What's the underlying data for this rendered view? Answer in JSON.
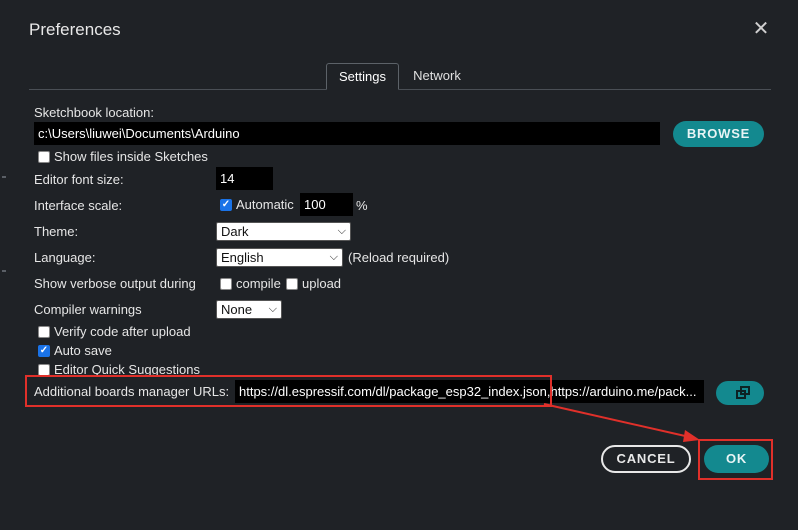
{
  "dialog": {
    "title": "Preferences"
  },
  "tabs": [
    {
      "label": "Settings",
      "active": true
    },
    {
      "label": "Network",
      "active": false
    }
  ],
  "sketchbook": {
    "label": "Sketchbook location:",
    "value": "c:\\Users\\liuwei\\Documents\\Arduino",
    "browse_label": "BROWSE",
    "show_files_label": "Show files inside Sketches",
    "show_files_checked": false
  },
  "font_size": {
    "label": "Editor font size:",
    "value": "14"
  },
  "scale": {
    "label": "Interface scale:",
    "automatic_label": "Automatic",
    "automatic_checked": true,
    "value": "100",
    "unit": "%"
  },
  "theme": {
    "label": "Theme:",
    "value": "Dark"
  },
  "language": {
    "label": "Language:",
    "value": "English",
    "note": "(Reload required)"
  },
  "verbose": {
    "label": "Show verbose output during",
    "compile_label": "compile",
    "compile_checked": false,
    "upload_label": "upload",
    "upload_checked": false
  },
  "warnings": {
    "label": "Compiler warnings",
    "value": "None"
  },
  "options": [
    {
      "label": "Verify code after upload",
      "checked": false
    },
    {
      "label": "Auto save",
      "checked": true
    },
    {
      "label": "Editor Quick Suggestions",
      "checked": false
    }
  ],
  "boards": {
    "label": "Additional boards manager URLs:",
    "value": "https://dl.espressif.com/dl/package_esp32_index.json,https://arduino.me/pack..."
  },
  "buttons": {
    "cancel": "CANCEL",
    "ok": "OK"
  },
  "colors": {
    "accent": "#13898f",
    "highlight": "#e0302a",
    "background": "#1f2226"
  }
}
